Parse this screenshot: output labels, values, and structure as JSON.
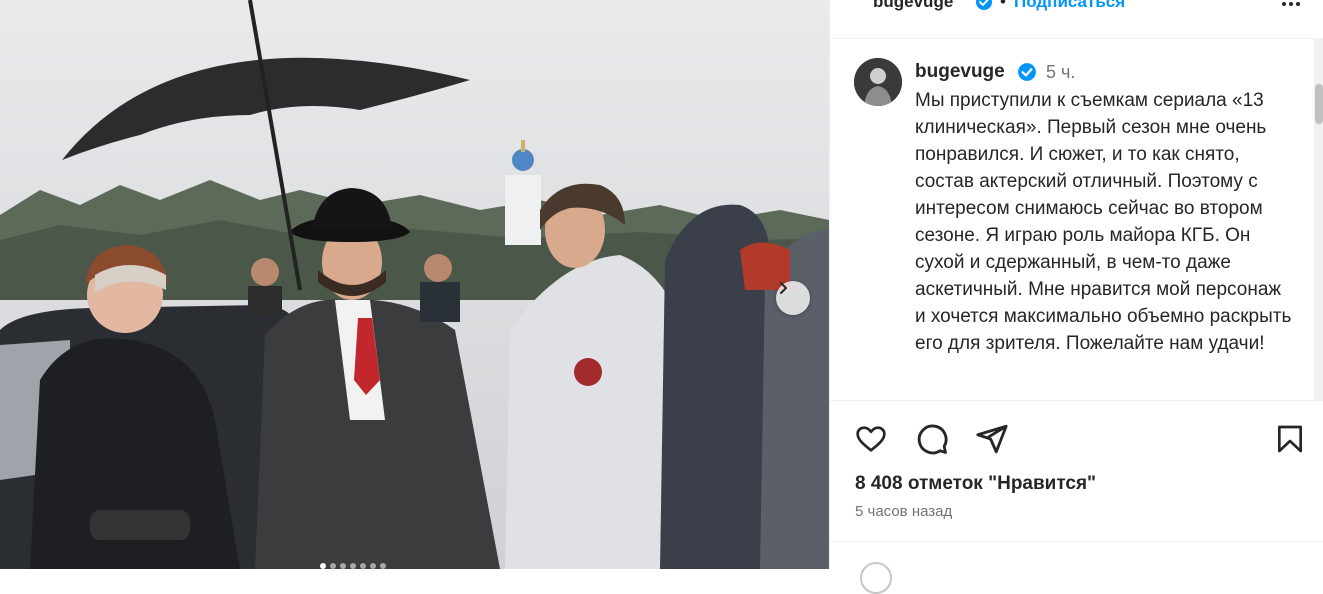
{
  "photo": {
    "next_icon": "chevron-right-icon",
    "carousel_total": 7,
    "carousel_active_index": 0
  },
  "header": {
    "username": "bugevuge",
    "separator": "•",
    "follow_label": "Подписаться",
    "more_icon": "more-horizontal-icon"
  },
  "caption": {
    "username": "bugevuge",
    "time": "5 ч.",
    "text": "Мы приступили к съемкам сериала «13 клиническая». Первый сезон мне очень понравился. И сюжет, и то как снято, состав актерский отличный. Поэтому с интересом снимаюсь сейчас во втором сезоне. Я играю роль майора КГБ. Он сухой и сдержанный, в чем-то даже аскетичный. Мне нравится мой персонаж и хочется максимально объемно раскрыть его для зрителя. Пожелайте нам удачи!"
  },
  "actions": {
    "like_icon": "heart-icon",
    "comment_icon": "comment-icon",
    "share_icon": "send-icon",
    "save_icon": "bookmark-icon"
  },
  "likes_text": "8 408 отметок \"Нравится\"",
  "time_ago": "5 часов назад",
  "colors": {
    "accent": "#0095f6",
    "verified": "#0095f6",
    "text": "#262626",
    "muted": "#737373"
  }
}
